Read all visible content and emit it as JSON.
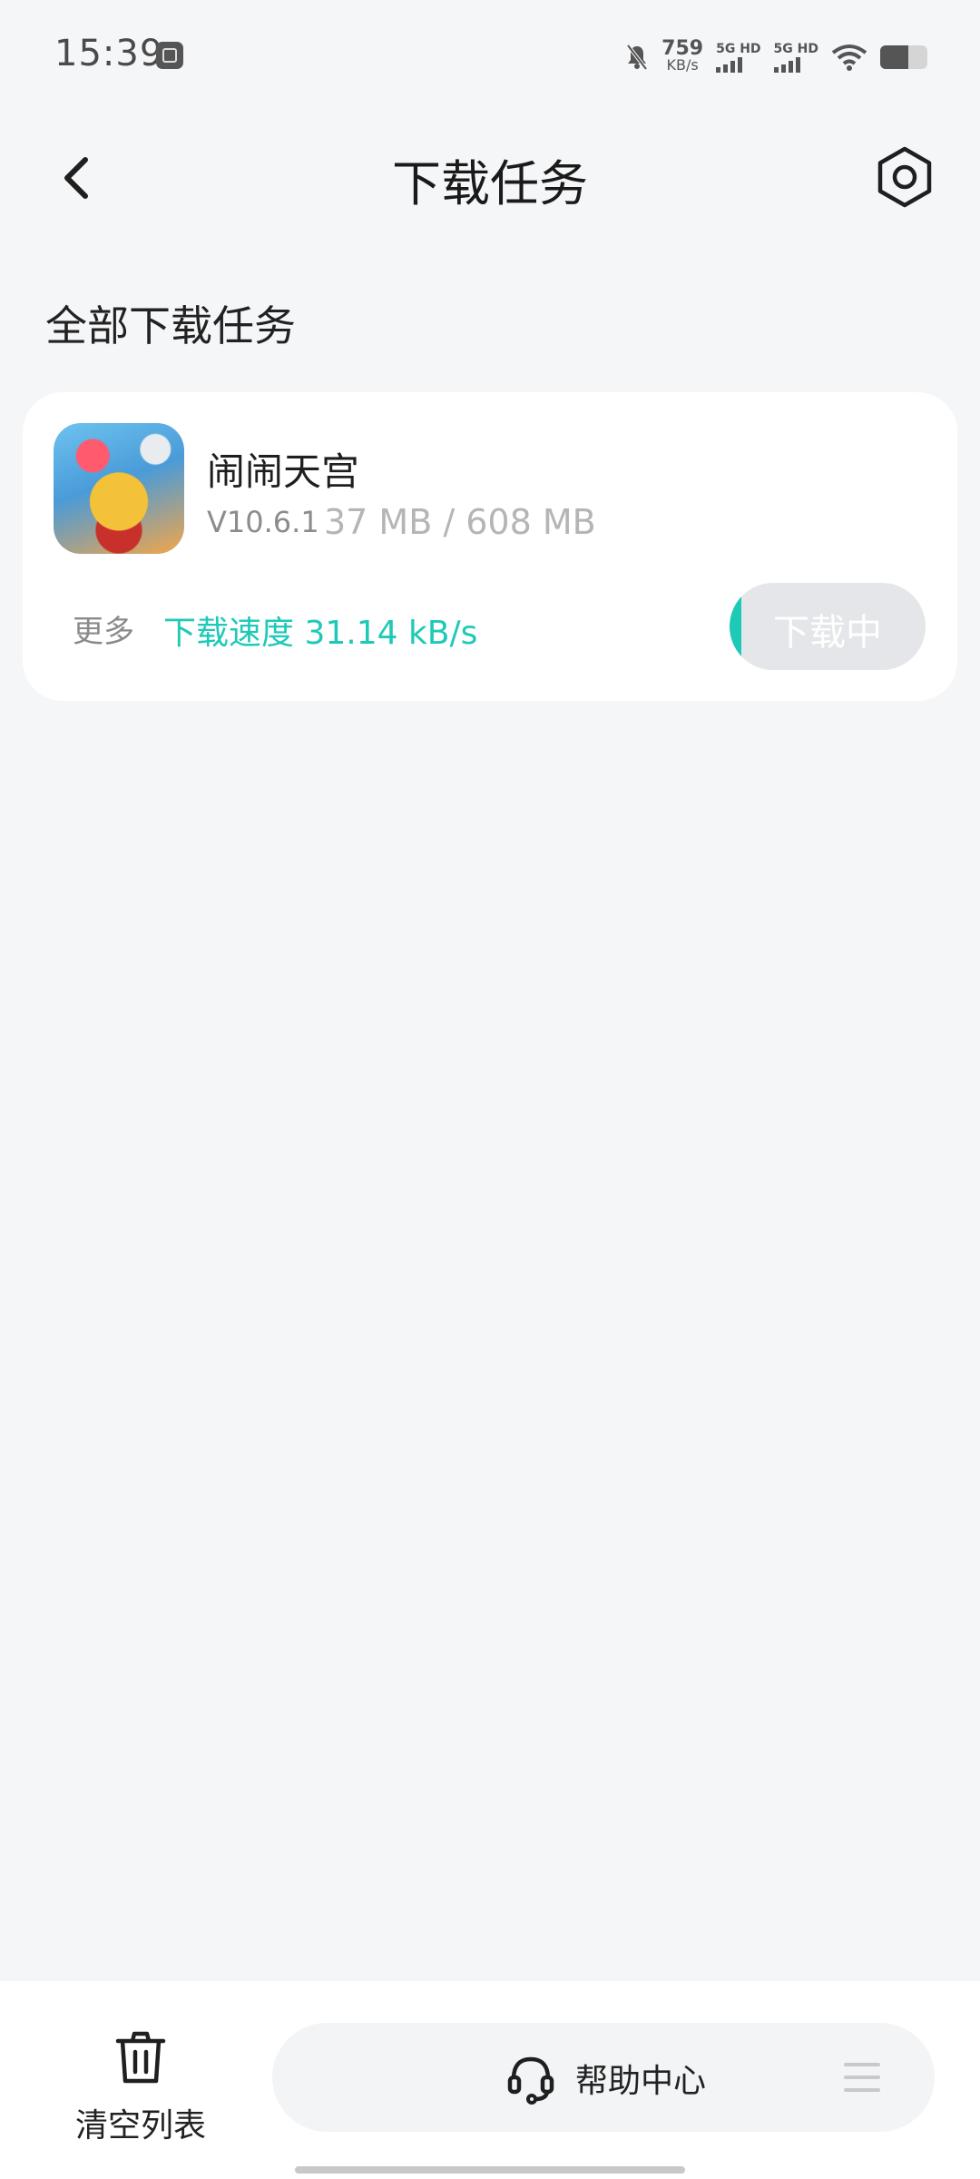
{
  "status_bar": {
    "time": "15:39",
    "net_speed_value": "759",
    "net_speed_unit": "KB/s",
    "sim1_label": "5G HD",
    "sim2_label": "5G HD",
    "icons": [
      "notifications-muted-icon",
      "signal-icon",
      "wifi-icon",
      "battery-icon"
    ],
    "battery_level": 0.6
  },
  "header": {
    "title": "下载任务",
    "back_icon": "back-arrow-icon",
    "settings_icon": "settings-icon"
  },
  "section": {
    "title": "全部下载任务"
  },
  "task": {
    "app_name": "闹闹天宫",
    "version": "V10.6.1",
    "size": "37 MB / 608 MB",
    "more_label": "更多",
    "speed_label": "下载速度 31.14 kB/s",
    "button_label": "下载中",
    "progress": 0.06,
    "colors": {
      "accent": "#1ec9b8",
      "button_bg": "#e4e6e9"
    }
  },
  "bottom": {
    "clear_label": "清空列表",
    "help_label": "帮助中心",
    "icons": [
      "trash-icon",
      "headset-icon",
      "menu-icon"
    ]
  }
}
